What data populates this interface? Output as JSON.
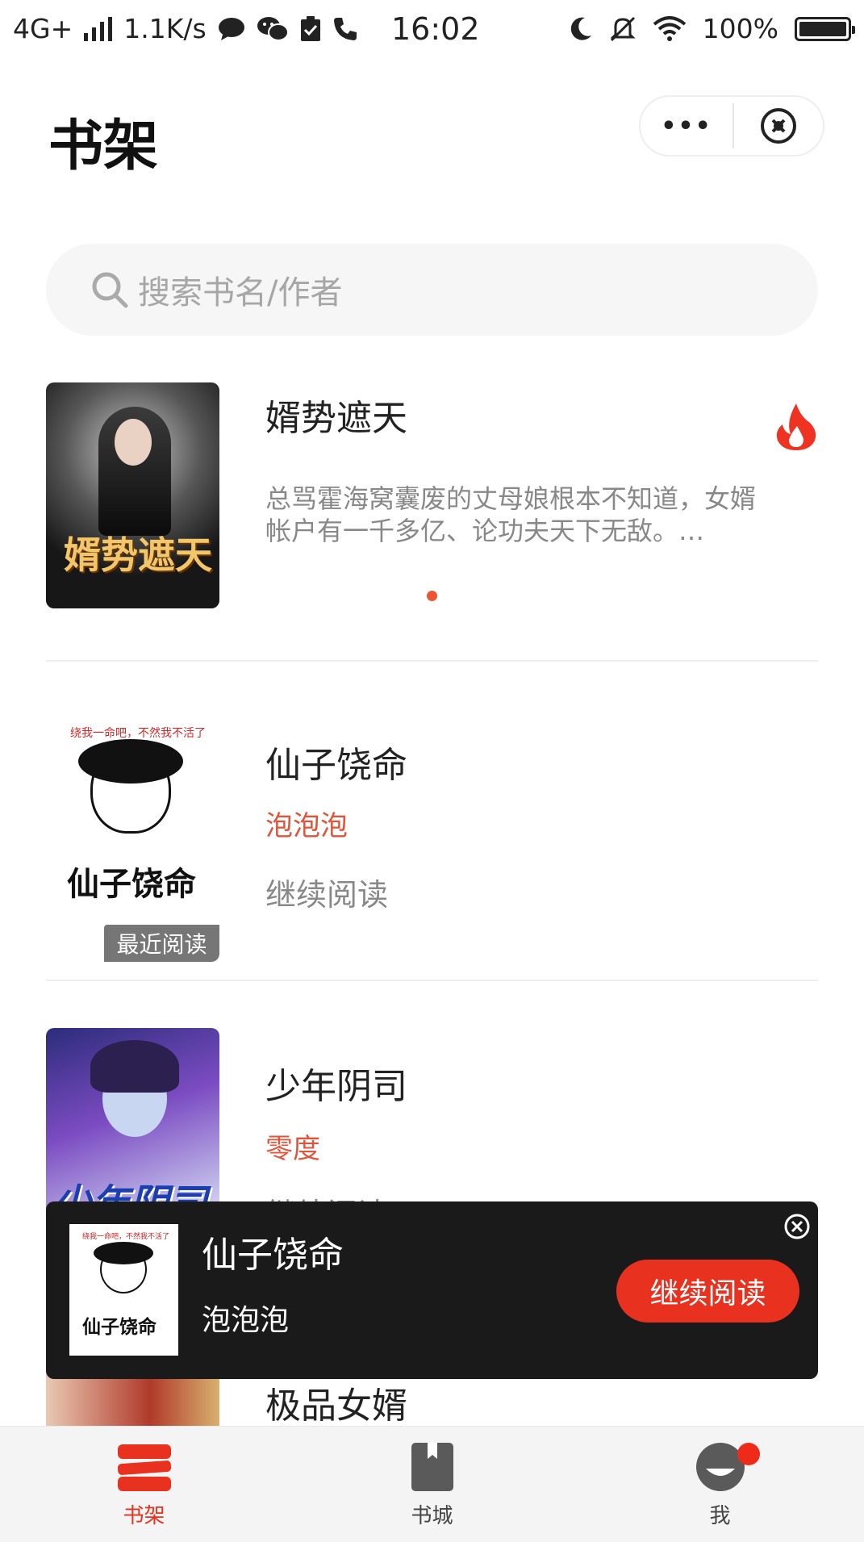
{
  "status_bar": {
    "network": "4G+",
    "speed": "1.1K/s",
    "time": "16:02",
    "battery": "100%"
  },
  "header": {
    "title": "书架",
    "more_label": "•••"
  },
  "search": {
    "placeholder": "搜索书名/作者"
  },
  "books": [
    {
      "title": "婿势遮天",
      "description": "总骂霍海窝囊废的丈母娘根本不知道，女婿帐户有一千多亿、论功夫天下无敌。…",
      "cover_text": "婿势遮天",
      "hot": true
    },
    {
      "title": "仙子饶命",
      "author": "泡泡泡",
      "action": "继续阅读",
      "badge": "最近阅读",
      "cover_text": "仙子饶命",
      "cover_tag": "绕我一命吧，不然我不活了"
    },
    {
      "title": "少年阴司",
      "author": "零度",
      "action": "继续阅读",
      "cover_text": "少年阴司"
    },
    {
      "title": "极品女婿"
    }
  ],
  "float_bar": {
    "title": "仙子饶命",
    "author": "泡泡泡",
    "button": "继续阅读",
    "cover_text": "仙子饶命",
    "cover_tag": "绕我一命吧，不然我不活了"
  },
  "tabs": [
    {
      "label": "书架",
      "active": true
    },
    {
      "label": "书城",
      "active": false
    },
    {
      "label": "我",
      "active": false
    }
  ],
  "colors": {
    "accent": "#e8311e",
    "author": "#e0553a",
    "muted": "#888888"
  }
}
